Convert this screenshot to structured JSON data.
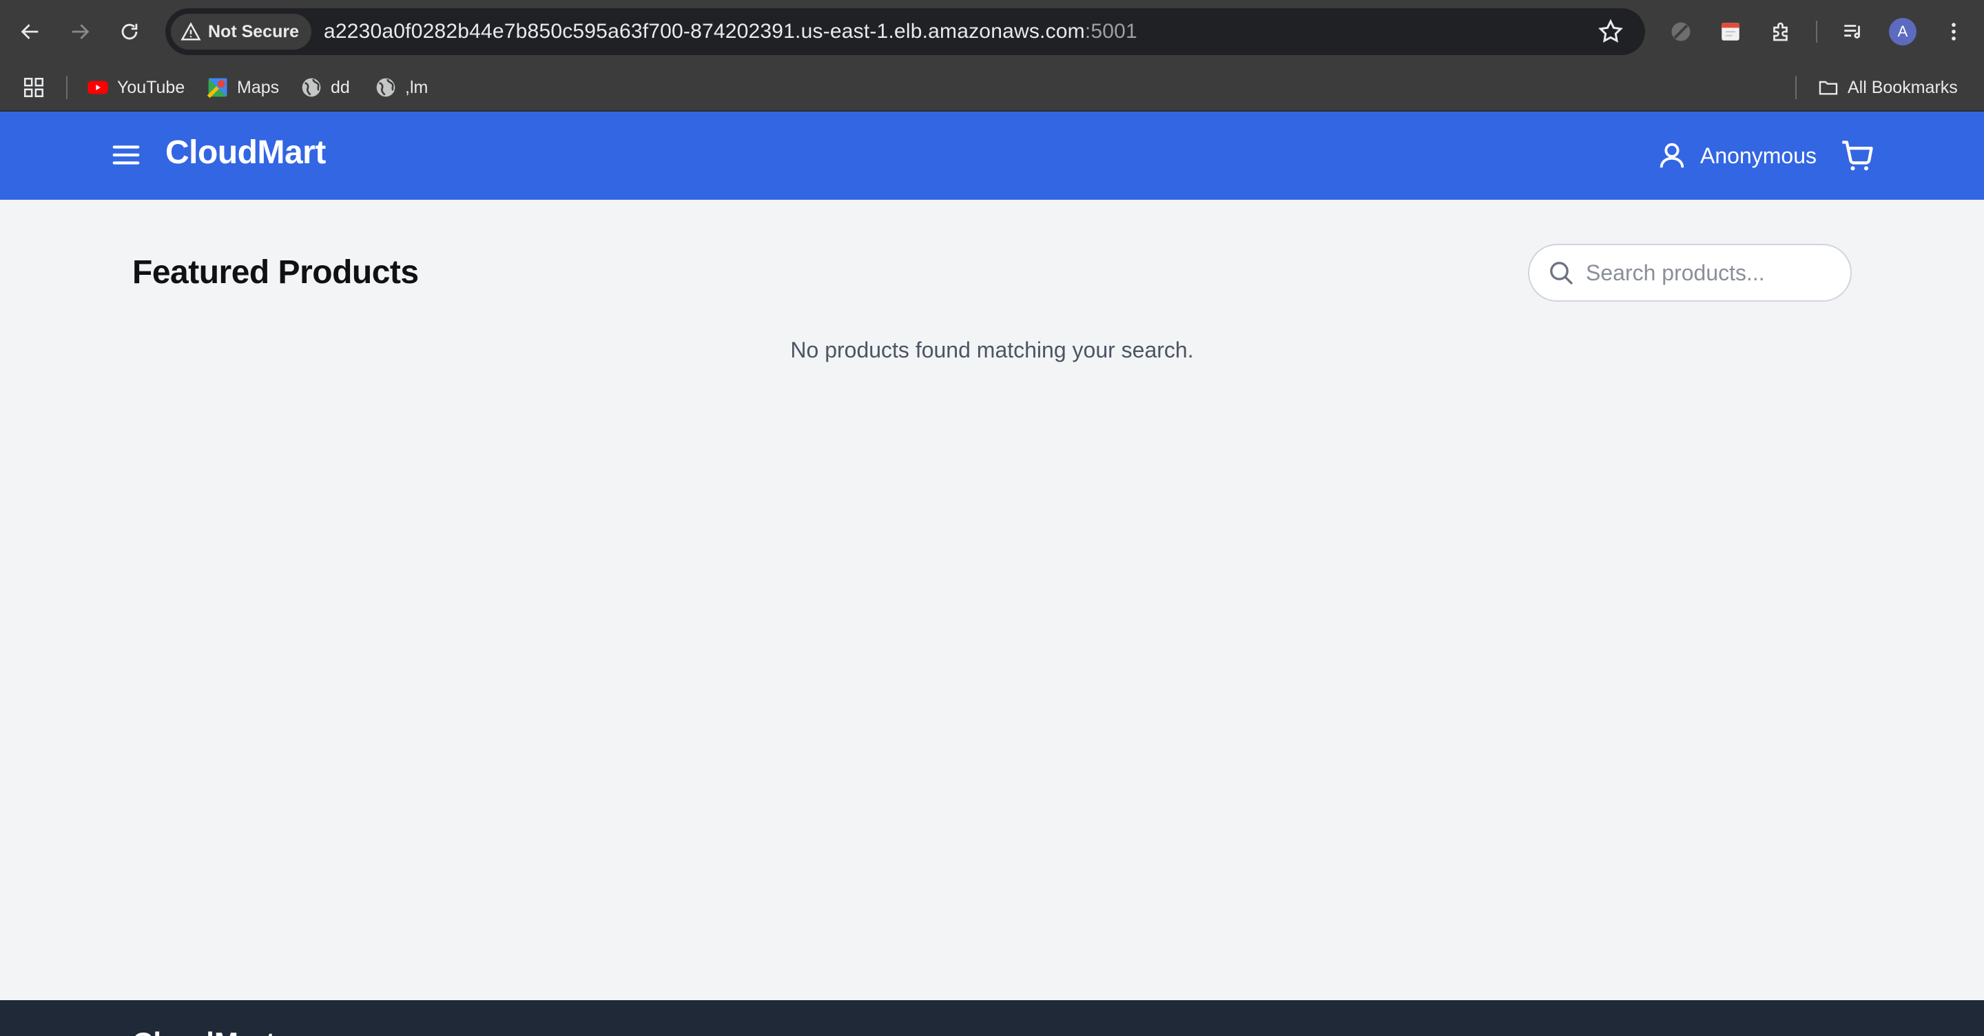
{
  "browser": {
    "security_label": "Not Secure",
    "url_host": "a2230a0f0282b44e7b850c595a63f700-874202391.us-east-1.elb.amazonaws.com",
    "url_port": ":5001",
    "profile_initial": "A",
    "bookmarks": [
      {
        "label": "YouTube",
        "icon": "youtube-icon"
      },
      {
        "label": "Maps",
        "icon": "maps-icon"
      },
      {
        "label": "dd",
        "icon": "globe-icon"
      },
      {
        "label": ",lm",
        "icon": "globe-icon"
      }
    ],
    "all_bookmarks_label": "All Bookmarks"
  },
  "app": {
    "brand": "CloudMart",
    "user_label": "Anonymous",
    "accent_color": "#3366e3"
  },
  "main": {
    "title": "Featured Products",
    "search_placeholder": "Search products...",
    "search_value": "",
    "empty_message": "No products found matching your search."
  },
  "footer": {
    "brand": "CloudMart"
  }
}
